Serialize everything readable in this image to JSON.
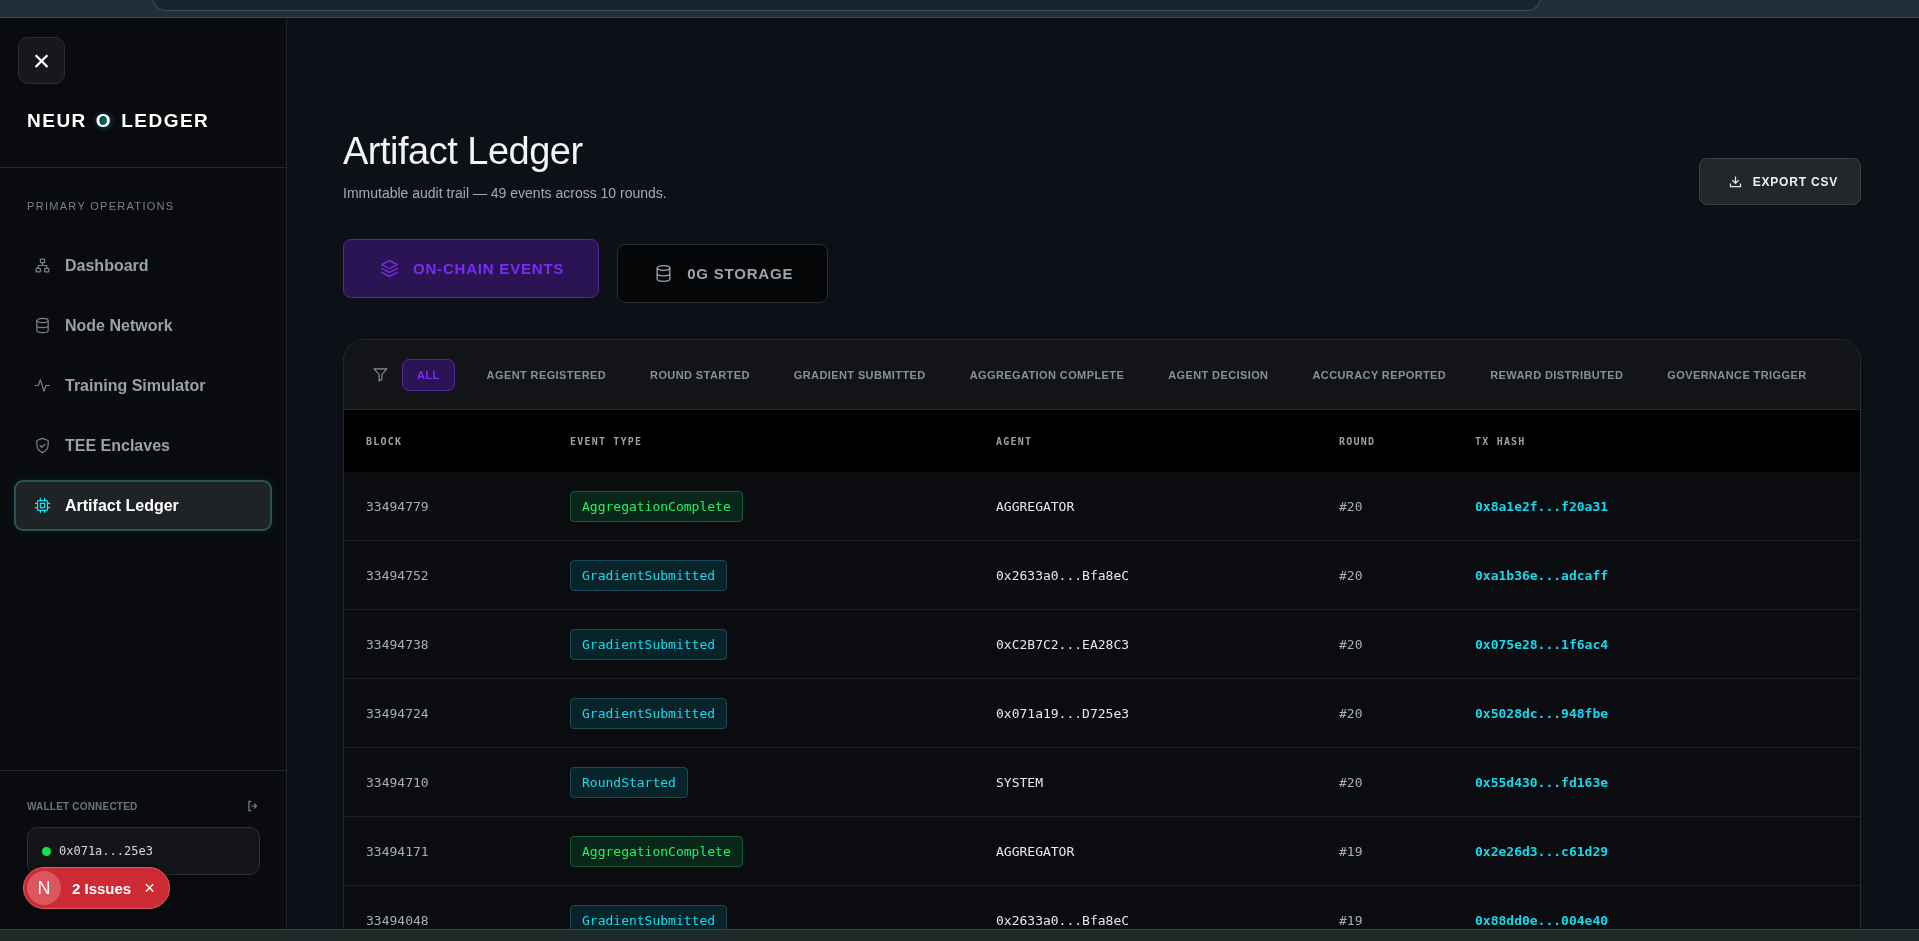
{
  "sidebar": {
    "close_label": "×",
    "logo": {
      "left": "NEUR",
      "glow_letter": "O",
      "right": "LEDGER"
    },
    "section_title": "PRIMARY OPERATIONS",
    "items": [
      {
        "label": "Dashboard",
        "selected": false
      },
      {
        "label": "Node Network",
        "selected": false
      },
      {
        "label": "Training Simulator",
        "selected": false
      },
      {
        "label": "TEE Enclaves",
        "selected": false
      },
      {
        "label": "Artifact Ledger",
        "selected": true
      }
    ],
    "wallet": {
      "label": "WALLET CONNECTED",
      "connected": true,
      "address": "0x071a...25e3"
    }
  },
  "issues_toast": {
    "badge": "N",
    "text": "2 Issues",
    "close": "×"
  },
  "header": {
    "title": "Artifact Ledger",
    "subtitle": "Immutable audit trail — 49 events across 10 rounds.",
    "export_button": "EXPORT CSV"
  },
  "view_tabs": [
    {
      "label": "ON-CHAIN EVENTS",
      "selected": true
    },
    {
      "label": "0G STORAGE",
      "selected": false
    }
  ],
  "filters": [
    {
      "label": "ALL",
      "selected": true
    },
    {
      "label": "AGENT REGISTERED",
      "selected": false
    },
    {
      "label": "ROUND STARTED",
      "selected": false
    },
    {
      "label": "GRADIENT SUBMITTED",
      "selected": false
    },
    {
      "label": "AGGREGATION COMPLETE",
      "selected": false
    },
    {
      "label": "AGENT DECISION",
      "selected": false
    },
    {
      "label": "ACCURACY REPORTED",
      "selected": false
    },
    {
      "label": "REWARD DISTRIBUTED",
      "selected": false
    },
    {
      "label": "GOVERNANCE TRIGGER",
      "selected": false
    }
  ],
  "table": {
    "columns": [
      "BLOCK",
      "EVENT TYPE",
      "AGENT",
      "ROUND",
      "TX HASH"
    ],
    "rows": [
      {
        "block": "33494779",
        "event": "AggregationComplete",
        "kind": "aggregation",
        "agent": "AGGREGATOR",
        "round": "#20",
        "tx_hash": "0x8a1e2f...f20a31"
      },
      {
        "block": "33494752",
        "event": "GradientSubmitted",
        "kind": "gradient",
        "agent": "0x2633a0...Bfa8eC",
        "round": "#20",
        "tx_hash": "0xa1b36e...adcaff"
      },
      {
        "block": "33494738",
        "event": "GradientSubmitted",
        "kind": "gradient",
        "agent": "0xC2B7C2...EA28C3",
        "round": "#20",
        "tx_hash": "0x075e28...1f6ac4"
      },
      {
        "block": "33494724",
        "event": "GradientSubmitted",
        "kind": "gradient",
        "agent": "0x071a19...D725e3",
        "round": "#20",
        "tx_hash": "0x5028dc...948fbe"
      },
      {
        "block": "33494710",
        "event": "RoundStarted",
        "kind": "round",
        "agent": "SYSTEM",
        "round": "#20",
        "tx_hash": "0x55d430...fd163e"
      },
      {
        "block": "33494171",
        "event": "AggregationComplete",
        "kind": "aggregation",
        "agent": "AGGREGATOR",
        "round": "#19",
        "tx_hash": "0x2e26d3...c61d29"
      },
      {
        "block": "33494048",
        "event": "GradientSubmitted",
        "kind": "gradient",
        "agent": "0x2633a0...Bfa8eC",
        "round": "#19",
        "tx_hash": "0x88dd0e...004e40"
      }
    ]
  }
}
